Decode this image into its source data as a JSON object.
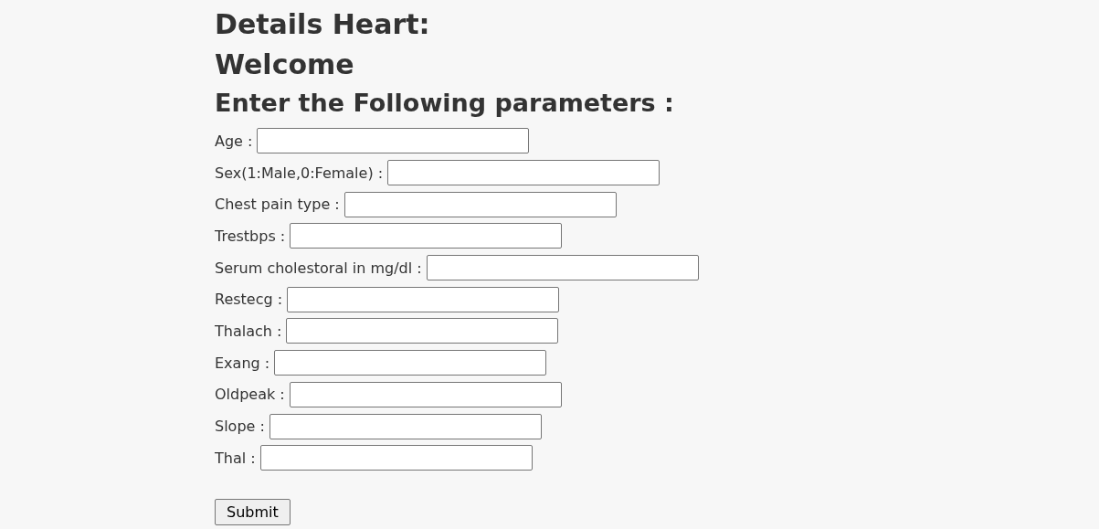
{
  "headings": [
    "Details Heart:",
    "Welcome",
    "Enter the Following parameters :"
  ],
  "fields": [
    {
      "label": "Age :"
    },
    {
      "label": "Sex(1:Male,0:Female) :"
    },
    {
      "label": "Chest pain type :"
    },
    {
      "label": "Trestbps :"
    },
    {
      "label": "Serum cholestoral in mg/dl :"
    },
    {
      "label": "Restecg :"
    },
    {
      "label": "Thalach :"
    },
    {
      "label": "Exang :"
    },
    {
      "label": "Oldpeak :"
    },
    {
      "label": "Slope :"
    },
    {
      "label": "Thal :"
    }
  ],
  "submit": "Submit"
}
